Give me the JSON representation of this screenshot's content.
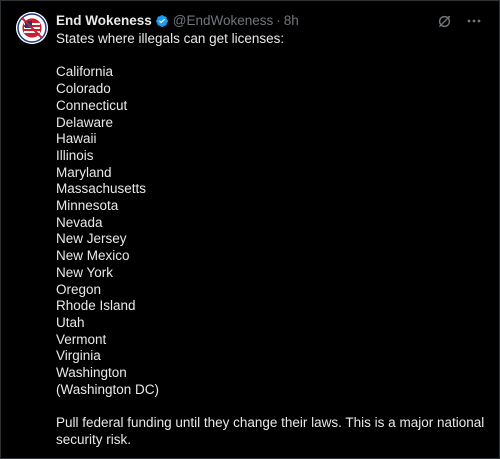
{
  "author": {
    "display_name": "End Wokeness",
    "handle": "@EndWokeness",
    "separator": "·",
    "time": "8h",
    "verified_color": "#1d9bf0"
  },
  "tweet": {
    "intro": "States where illegals can get licenses:",
    "states": [
      "California",
      "Colorado",
      "Connecticut",
      "Delaware",
      "Hawaii",
      "Illinois",
      "Maryland",
      "Massachusetts",
      "Minnesota",
      "Nevada",
      "New Jersey",
      "New Mexico",
      "New York",
      "Oregon",
      "Rhode Island",
      "Utah",
      "Vermont",
      "Virginia",
      "Washington",
      "(Washington DC)"
    ],
    "closing": "Pull federal funding until they change their laws. This is a major national security risk."
  },
  "icons": {
    "grok": "grok-icon",
    "more": "more-icon",
    "avatar": "avatar-logo"
  }
}
